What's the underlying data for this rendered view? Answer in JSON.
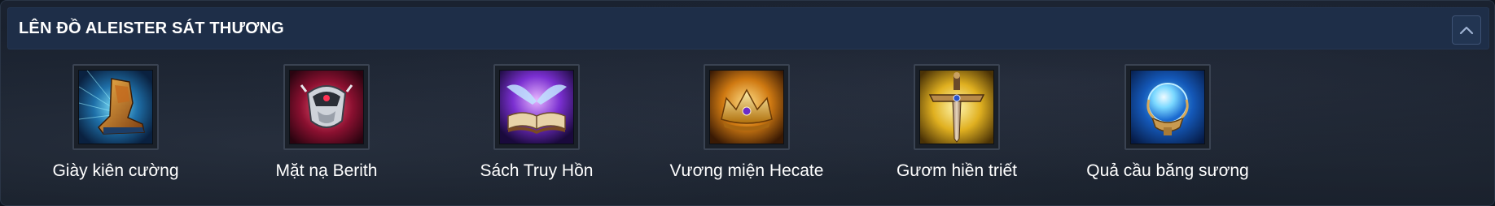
{
  "header": {
    "title": "LÊN ĐỒ ALEISTER SÁT THƯƠNG",
    "collapse_icon": "chevron-up-icon"
  },
  "items": [
    {
      "label": "Giày kiên cường",
      "icon": "boots-icon"
    },
    {
      "label": "Mặt nạ Berith",
      "icon": "mask-icon"
    },
    {
      "label": "Sách Truy Hồn",
      "icon": "book-icon"
    },
    {
      "label": "Vương miện Hecate",
      "icon": "crown-icon"
    },
    {
      "label": "Gươm hiền triết",
      "icon": "sword-icon"
    },
    {
      "label": "Quả cầu băng sương",
      "icon": "frost-orb-icon"
    }
  ],
  "colors": {
    "header_bg": "#1e2e48",
    "panel_bg": "#141b25",
    "text": "#ffffff"
  }
}
